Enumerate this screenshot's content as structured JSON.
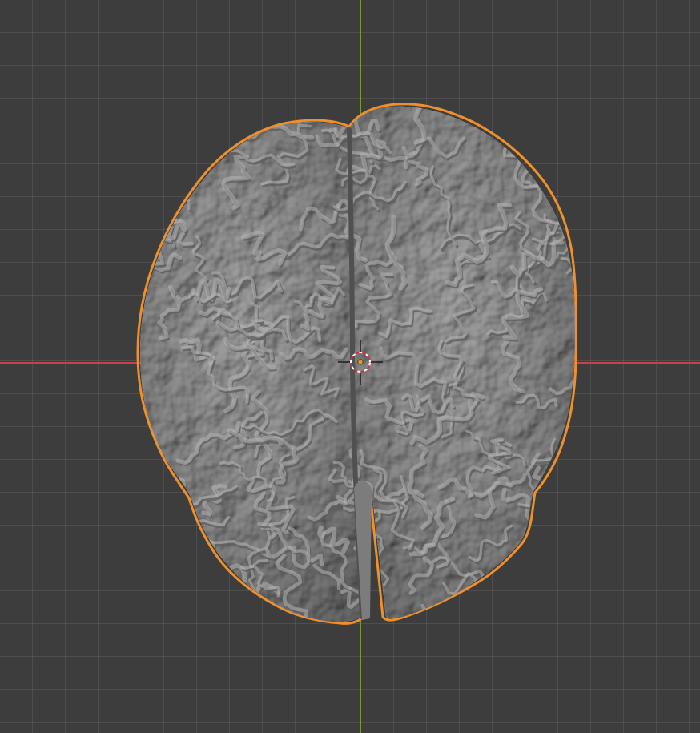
{
  "viewport": {
    "name": "3D Viewport",
    "grid_visible": true
  },
  "colors": {
    "background": "#3d3d3d",
    "grid": "#4a4a4a",
    "x_axis": "#c8404a",
    "y_axis": "#7a9a2e",
    "selection_outline": "#f0902a",
    "mesh_base": "#8f8f8f",
    "mesh_highlight": "#b5b5b5",
    "mesh_shadow": "#5c5c5c",
    "origin_dot": "#f0902a"
  },
  "scene": {
    "active_object": {
      "type": "mesh",
      "icon": "brain-mesh-icon",
      "selected": true
    },
    "cursor": {
      "icon": "3d-cursor-icon"
    },
    "origin": {
      "icon": "object-origin-icon"
    }
  }
}
